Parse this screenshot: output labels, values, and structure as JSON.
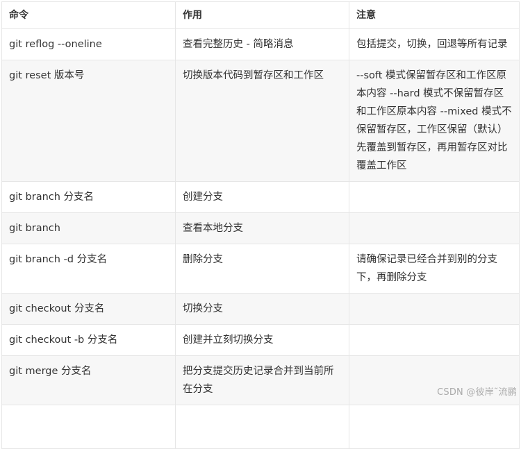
{
  "table": {
    "headers": [
      "命令",
      "作用",
      "注意"
    ],
    "rows": [
      {
        "cmd": "git reflog --oneline",
        "use": "查看完整历史 - 简略消息",
        "note": "包括提交，切换，回退等所有记录"
      },
      {
        "cmd": "git reset 版本号",
        "use": "切换版本代码到暂存区和工作区",
        "note": "--soft 模式保留暂存区和工作区原本内容 --hard 模式不保留暂存区和工作区原本内容 --mixed 模式不保留暂存区，工作区保留（默认） 先覆盖到暂存区，再用暂存区对比覆盖工作区"
      },
      {
        "cmd": "git branch 分支名",
        "use": "创建分支",
        "note": ""
      },
      {
        "cmd": "git branch",
        "use": "查看本地分支",
        "note": ""
      },
      {
        "cmd": "git branch -d 分支名",
        "use": "删除分支",
        "note": "请确保记录已经合并到别的分支下，再删除分支"
      },
      {
        "cmd": "git checkout 分支名",
        "use": "切换分支",
        "note": ""
      },
      {
        "cmd": "git checkout -b 分支名",
        "use": "创建并立刻切换分支",
        "note": ""
      },
      {
        "cmd": "git merge 分支名",
        "use": "把分支提交历史记录合并到当前所在分支",
        "note": ""
      }
    ]
  },
  "watermark": "CSDN @彼岸˜流鹂"
}
